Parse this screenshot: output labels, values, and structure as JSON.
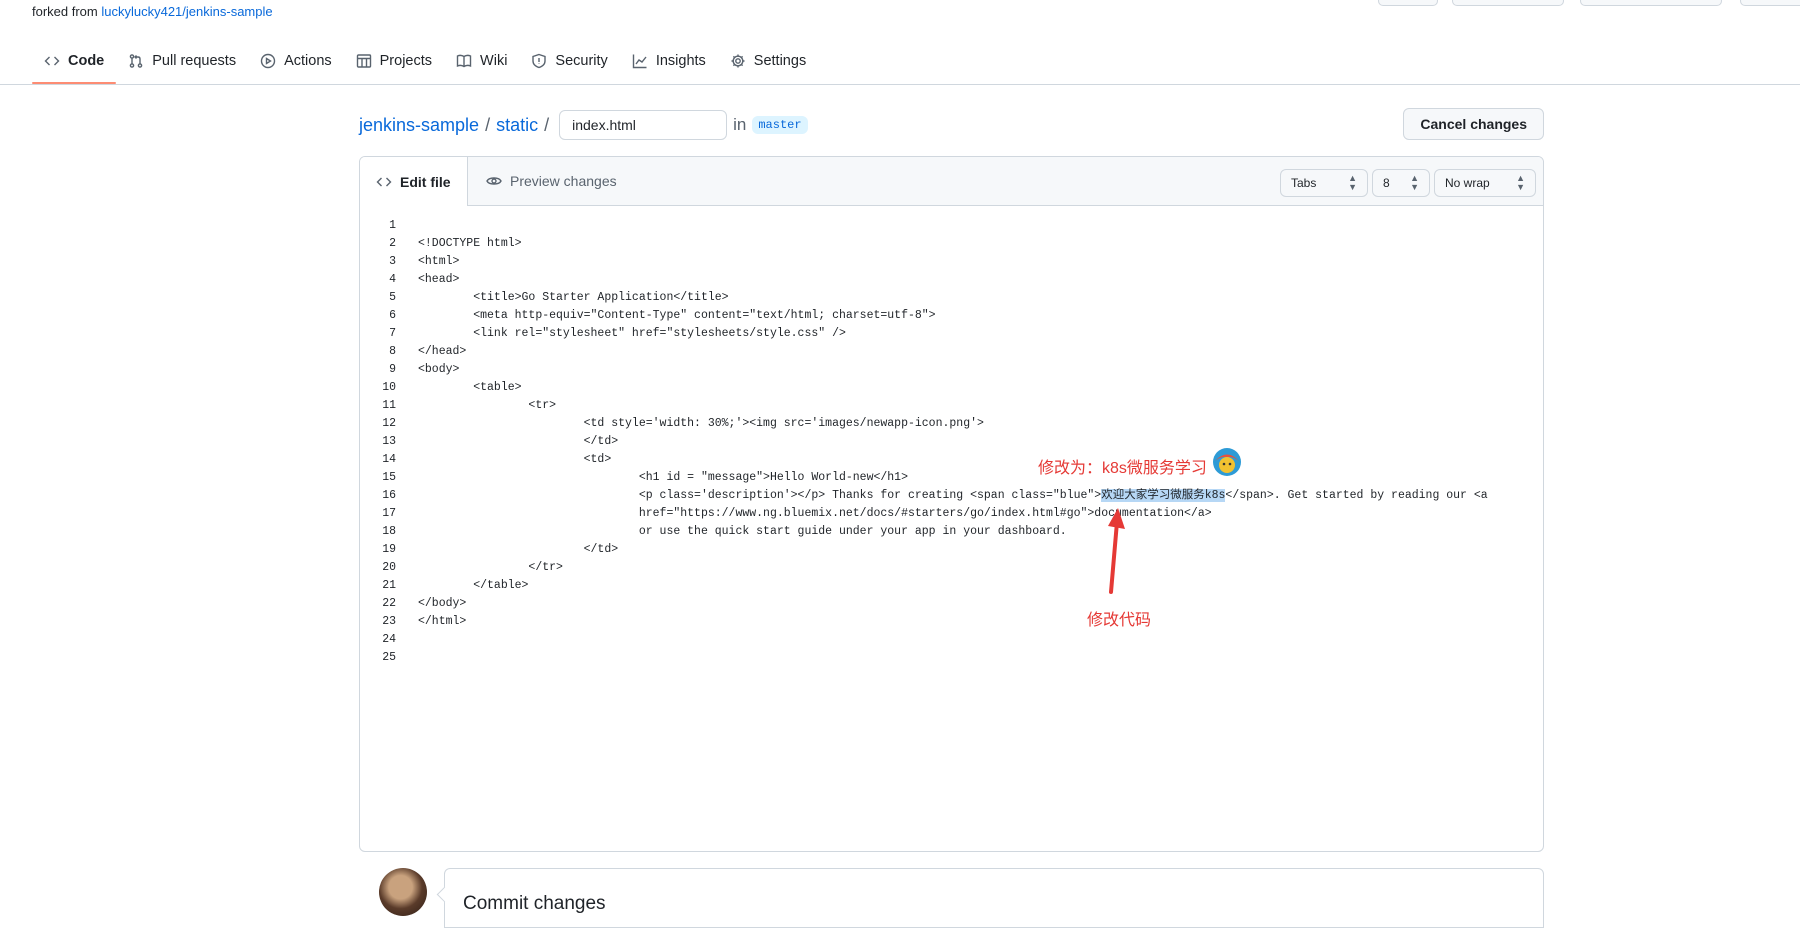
{
  "forked": {
    "prefix": "forked from ",
    "link": "luckylucky421/jenkins-sample"
  },
  "nav": {
    "tabs": [
      {
        "label": "Code",
        "icon": "code-icon"
      },
      {
        "label": "Pull requests",
        "icon": "pull-request-icon"
      },
      {
        "label": "Actions",
        "icon": "play-icon"
      },
      {
        "label": "Projects",
        "icon": "table-icon"
      },
      {
        "label": "Wiki",
        "icon": "book-icon"
      },
      {
        "label": "Security",
        "icon": "shield-icon"
      },
      {
        "label": "Insights",
        "icon": "graph-icon"
      },
      {
        "label": "Settings",
        "icon": "gear-icon"
      }
    ]
  },
  "breadcrumb": {
    "repo": "jenkins-sample",
    "sep": "/",
    "dir": "static",
    "filename": "index.html",
    "in": "in",
    "branch": "master"
  },
  "cancel_label": "Cancel changes",
  "editor": {
    "edit_tab": "Edit file",
    "preview_tab": "Preview changes",
    "indent_mode": "Tabs",
    "indent_size": "8",
    "wrap_mode": "No wrap"
  },
  "code_lines": [
    {
      "n": "1",
      "t": ""
    },
    {
      "n": "2",
      "t": "<!DOCTYPE html>"
    },
    {
      "n": "3",
      "t": "<html>"
    },
    {
      "n": "4",
      "t": "<head>"
    },
    {
      "n": "5",
      "t": "        <title>Go Starter Application</title>"
    },
    {
      "n": "6",
      "t": "        <meta http-equiv=\"Content-Type\" content=\"text/html; charset=utf-8\">"
    },
    {
      "n": "7",
      "t": "        <link rel=\"stylesheet\" href=\"stylesheets/style.css\" />"
    },
    {
      "n": "8",
      "t": "</head>"
    },
    {
      "n": "9",
      "t": "<body>"
    },
    {
      "n": "10",
      "t": "        <table>"
    },
    {
      "n": "11",
      "t": "                <tr>"
    },
    {
      "n": "12",
      "t": "                        <td style='width: 30%;'><img src='images/newapp-icon.png'>"
    },
    {
      "n": "13",
      "t": "                        </td>"
    },
    {
      "n": "14",
      "t": "                        <td>"
    },
    {
      "n": "15",
      "t": "                                <h1 id = \"message\">Hello World-new</h1>"
    },
    {
      "n": "16",
      "t": "                                <p class='description'></p> Thanks for creating <span class=\"blue\">",
      "hl": "欢迎大家学习微服务k8s",
      "rest": "</span>. Get started by reading our <a"
    },
    {
      "n": "17",
      "t": "                                href=\"https://www.ng.bluemix.net/docs/#starters/go/index.html#go\">documentation</a>"
    },
    {
      "n": "18",
      "t": "                                or use the quick start guide under your app in your dashboard."
    },
    {
      "n": "19",
      "t": "                        </td>"
    },
    {
      "n": "20",
      "t": "                </tr>"
    },
    {
      "n": "21",
      "t": "        </table>"
    },
    {
      "n": "22",
      "t": "</body>"
    },
    {
      "n": "23",
      "t": "</html>"
    },
    {
      "n": "24",
      "t": ""
    },
    {
      "n": "25",
      "t": ""
    }
  ],
  "annotations": {
    "change_to": "修改为：k8s微服务学习",
    "modify_code": "修改代码",
    "arrow_color": "#e53935"
  },
  "commit": {
    "title": "Commit changes"
  }
}
